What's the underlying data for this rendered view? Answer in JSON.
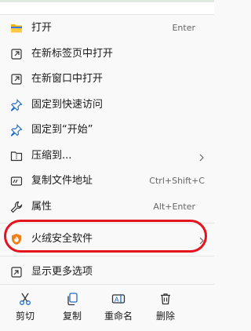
{
  "menu": {
    "open": {
      "label": "打开",
      "shortcut": "Enter",
      "icon": "folder-icon"
    },
    "open_new_tab": {
      "label": "在新标签页中打开",
      "icon": "new-tab-icon"
    },
    "open_new_window": {
      "label": "在新窗口中打开",
      "icon": "new-window-icon"
    },
    "pin_quick_access": {
      "label": "固定到快速访问",
      "icon": "pin-icon"
    },
    "pin_start": {
      "label": "固定到“开始”",
      "icon": "pin-icon"
    },
    "compress": {
      "label": "压缩到...",
      "icon": "zip-folder-icon"
    },
    "copy_path": {
      "label": "复制文件地址",
      "shortcut": "Ctrl+Shift+C",
      "icon": "copy-path-icon"
    },
    "properties": {
      "label": "属性",
      "shortcut": "Alt+Enter",
      "icon": "wrench-icon"
    },
    "huorong": {
      "label": "火绒安全软件",
      "icon": "huorong-shield-icon"
    },
    "more_options": {
      "label": "显示更多选项",
      "icon": "more-options-icon"
    }
  },
  "quick_actions": {
    "cut": {
      "label": "剪切",
      "icon": "scissors-icon"
    },
    "copy": {
      "label": "复制",
      "icon": "copy-icon"
    },
    "rename": {
      "label": "重命名",
      "icon": "rename-icon"
    },
    "delete": {
      "label": "删除",
      "icon": "trash-icon"
    }
  },
  "colors": {
    "highlight_ring": "#e3141e",
    "folder": "#f4b400",
    "pin": "#1e6fd0",
    "huorong": "#f07f18"
  }
}
